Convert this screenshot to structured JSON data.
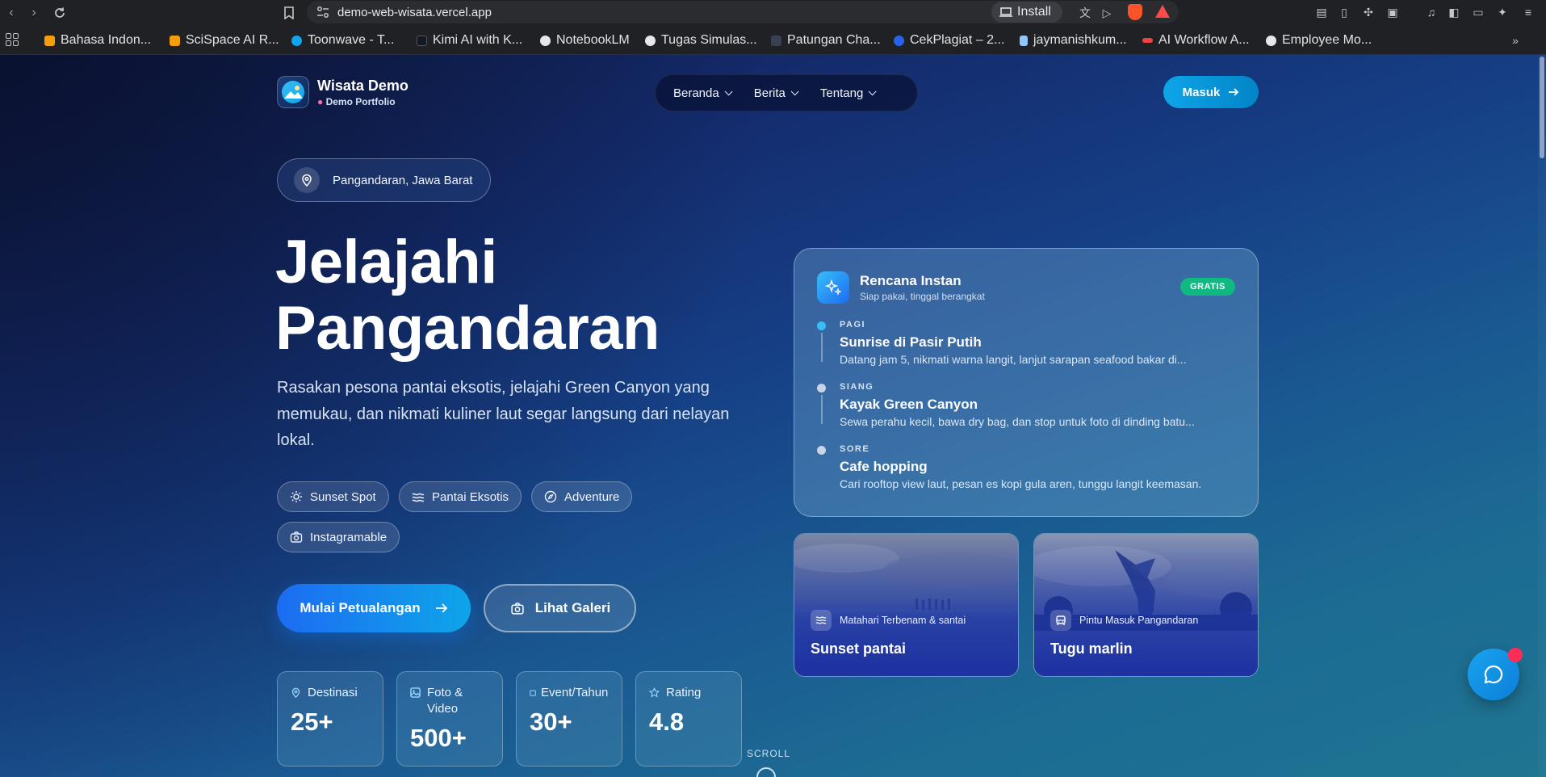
{
  "browser": {
    "url": "demo-web-wisata.vercel.app",
    "install_label": "Install",
    "bookmarks": [
      {
        "label": "Bahasa Indon...",
        "color": "#f59e0b"
      },
      {
        "label": "SciSpace AI R...",
        "color": "#f59e0b"
      },
      {
        "label": "Toonwave - T...",
        "color": "#0ea5e9"
      },
      {
        "label": "Kimi AI with K...",
        "color": "#111827"
      },
      {
        "label": "NotebookLM",
        "color": "#e5e7eb"
      },
      {
        "label": "Tugas Simulas...",
        "color": "#e5e7eb"
      },
      {
        "label": "Patungan Cha...",
        "color": "#374151"
      },
      {
        "label": "CekPlagiat – 2...",
        "color": "#2563eb"
      },
      {
        "label": "jaymanishkum...",
        "color": "#93c5fd"
      },
      {
        "label": "AI Workflow A...",
        "color": "#ef4444"
      },
      {
        "label": "Employee Mo...",
        "color": "#e5e7eb"
      }
    ]
  },
  "site": {
    "brand_name": "Wisata Demo",
    "brand_sub": "Demo Portfolio",
    "nav": [
      {
        "label": "Beranda"
      },
      {
        "label": "Berita"
      },
      {
        "label": "Tentang"
      }
    ],
    "login_label": "Masuk"
  },
  "hero": {
    "location": "Pangandaran, Jawa Barat",
    "title_line1": "Jelajahi",
    "title_line2": "Pangandaran",
    "description": "Rasakan pesona pantai eksotis, jelajahi Green Canyon yang memukau, dan nikmati kuliner laut segar langsung dari nelayan lokal.",
    "tags": [
      {
        "label": "Sunset Spot",
        "icon": "sun-icon"
      },
      {
        "label": "Pantai Eksotis",
        "icon": "waves-icon"
      },
      {
        "label": "Adventure",
        "icon": "compass-icon"
      },
      {
        "label": "Instagramable",
        "icon": "camera-icon"
      }
    ],
    "cta_primary": "Mulai Petualangan",
    "cta_secondary": "Lihat Galeri",
    "stats": [
      {
        "label": "Destinasi",
        "value": "25+",
        "icon": "map-pin-icon"
      },
      {
        "label": "Foto & Video",
        "value": "500+",
        "icon": "image-icon"
      },
      {
        "label": "Event/Tahun",
        "value": "30+",
        "icon": "calendar-icon"
      },
      {
        "label": "Rating",
        "value": "4.8",
        "icon": "star-icon"
      }
    ],
    "scroll_label": "SCROLL"
  },
  "plan": {
    "title": "Rencana Instan",
    "subtitle": "Siap pakai, tinggal berangkat",
    "badge": "GRATIS",
    "items": [
      {
        "period": "PAGI",
        "title": "Sunrise di Pasir Putih",
        "desc": "Datang jam 5, nikmati warna langit, lanjut sarapan seafood bakar di...",
        "dot_color": "#38bdf8"
      },
      {
        "period": "SIANG",
        "title": "Kayak Green Canyon",
        "desc": "Sewa perahu kecil, bawa dry bag, dan stop untuk foto di dinding batu...",
        "dot_color": "#c7d5e6"
      },
      {
        "period": "SORE",
        "title": "Cafe hopping",
        "desc": "Cari rooftop view laut, pesan es kopi gula aren, tunggu langit keemasan.",
        "dot_color": "#c7d5e6"
      }
    ]
  },
  "gallery": [
    {
      "caption": "Matahari Terbenam & santai",
      "title": "Sunset pantai",
      "icon": "waves-icon"
    },
    {
      "caption": "Pintu Masuk Pangandaran",
      "title": "Tugu marlin",
      "icon": "car-icon"
    }
  ],
  "colors": {
    "accent": "#0ea5e9",
    "primary_button": "#1d6cf2",
    "badge_green": "#10b981",
    "notification": "#ff2d55"
  }
}
